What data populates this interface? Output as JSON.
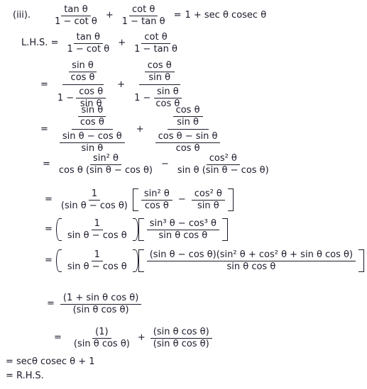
{
  "document": {
    "type": "trigonometric-identity-proof",
    "part_label": "(iii).",
    "lhs_label": "L.H.S. =",
    "equals": "=",
    "plus": "+",
    "minus": "−",
    "theta": "θ"
  },
  "statement": {
    "term1": {
      "num": "tan θ",
      "den": "1 − cot θ"
    },
    "term2": {
      "num": "cot θ",
      "den": "1 − tan θ"
    },
    "rhs": "1 + sec θ cosec θ"
  },
  "step1": {
    "term1": {
      "num": "tan θ",
      "den": "1 − cot θ"
    },
    "term2": {
      "num": "cot θ",
      "den": "1 − tan θ"
    }
  },
  "step2": {
    "term1": {
      "num": {
        "num": "sin θ",
        "den": "cos θ"
      },
      "den_lead": "1 −",
      "den": {
        "num": "cos θ",
        "den": "sin θ"
      }
    },
    "term2": {
      "num": {
        "num": "cos θ",
        "den": "sin θ"
      },
      "den_lead": "1 −",
      "den": {
        "num": "sin θ",
        "den": "cos θ"
      }
    }
  },
  "step3": {
    "term1": {
      "num": {
        "num": "sin θ",
        "den": "cos θ"
      },
      "den": {
        "num": "sin θ − cos θ",
        "den": "sin θ"
      }
    },
    "term2": {
      "num": {
        "num": "cos θ",
        "den": "sin θ"
      },
      "den": {
        "num": "cos θ − sin θ",
        "den": "cos θ"
      }
    }
  },
  "step4": {
    "term1": {
      "num": "sin² θ",
      "den": "cos θ (sin θ − cos θ)"
    },
    "term2": {
      "num": "cos² θ",
      "den": "sin θ (sin θ − cos θ)"
    }
  },
  "step5": {
    "factor": {
      "num": "1",
      "den": "(sin θ − cos θ)"
    },
    "bracket": {
      "term1": {
        "num": "sin² θ",
        "den": "cos θ"
      },
      "term2": {
        "num": "cos² θ",
        "den": "sin θ"
      }
    }
  },
  "step6": {
    "factor": {
      "num": "1",
      "den": "sin θ − cos θ"
    },
    "bracket": {
      "num": "sin³ θ − cos³ θ",
      "den": "sin θ cos θ"
    }
  },
  "step7": {
    "factor": {
      "num": "1",
      "den": "sin θ − cos θ"
    },
    "bracket": {
      "num": "(sin θ − cos θ)(sin² θ + cos² θ + sin θ cos θ)",
      "den": "sin θ cos θ"
    }
  },
  "step8": {
    "num": "(1 + sin θ cos θ)",
    "den": "(sin θ cos θ)"
  },
  "step9": {
    "term1": {
      "num": "(1)",
      "den": "(sin θ cos θ)"
    },
    "term2": {
      "num": "(sin θ cos θ)",
      "den": "(sin θ cos θ)"
    }
  },
  "conclusion": {
    "line1": "= secθ cosec θ + 1",
    "line2": "= R.H.S."
  }
}
